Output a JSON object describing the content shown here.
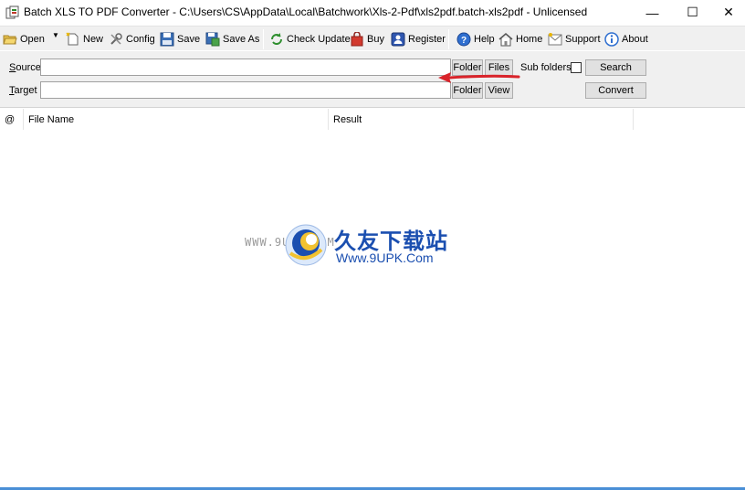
{
  "window": {
    "title": "Batch XLS TO PDF Converter - C:\\Users\\CS\\AppData\\Local\\Batchwork\\Xls-2-Pdf\\xls2pdf.batch-xls2pdf - Unlicensed",
    "minimize_glyph": "—",
    "maximize_glyph": "☐",
    "close_glyph": "✕"
  },
  "toolbar": {
    "open": "Open",
    "new": "New",
    "config": "Config",
    "save": "Save",
    "save_as": "Save As",
    "check_update": "Check Update",
    "buy": "Buy",
    "register": "Register",
    "help": "Help",
    "home": "Home",
    "support": "Support",
    "about": "About"
  },
  "form": {
    "source_label_first": "S",
    "source_label_rest": "ource",
    "target_label_first": "T",
    "target_label_rest": "arget",
    "source_value": "",
    "target_value": "",
    "source_folder_button": "Folder",
    "files_button": "Files",
    "sub_folders_label": "Sub folders",
    "sub_folders_checked": false,
    "search_button": "Search",
    "target_folder_button": "Folder",
    "view_button": "View",
    "convert_button": "Convert"
  },
  "list": {
    "columns": [
      "@",
      "File Name",
      "Result"
    ],
    "rows": []
  },
  "watermark": {
    "small_url": "WWW.9UPK.COM",
    "chinese_name": "久友下载站",
    "url": "Www.9UPK.Com"
  },
  "colors": {
    "toolbar_bg": "#f0f0f0",
    "watermark_blue": "#1b4fb0",
    "arrow_red": "#d9232a",
    "accent_line": "#4a8fd6"
  }
}
